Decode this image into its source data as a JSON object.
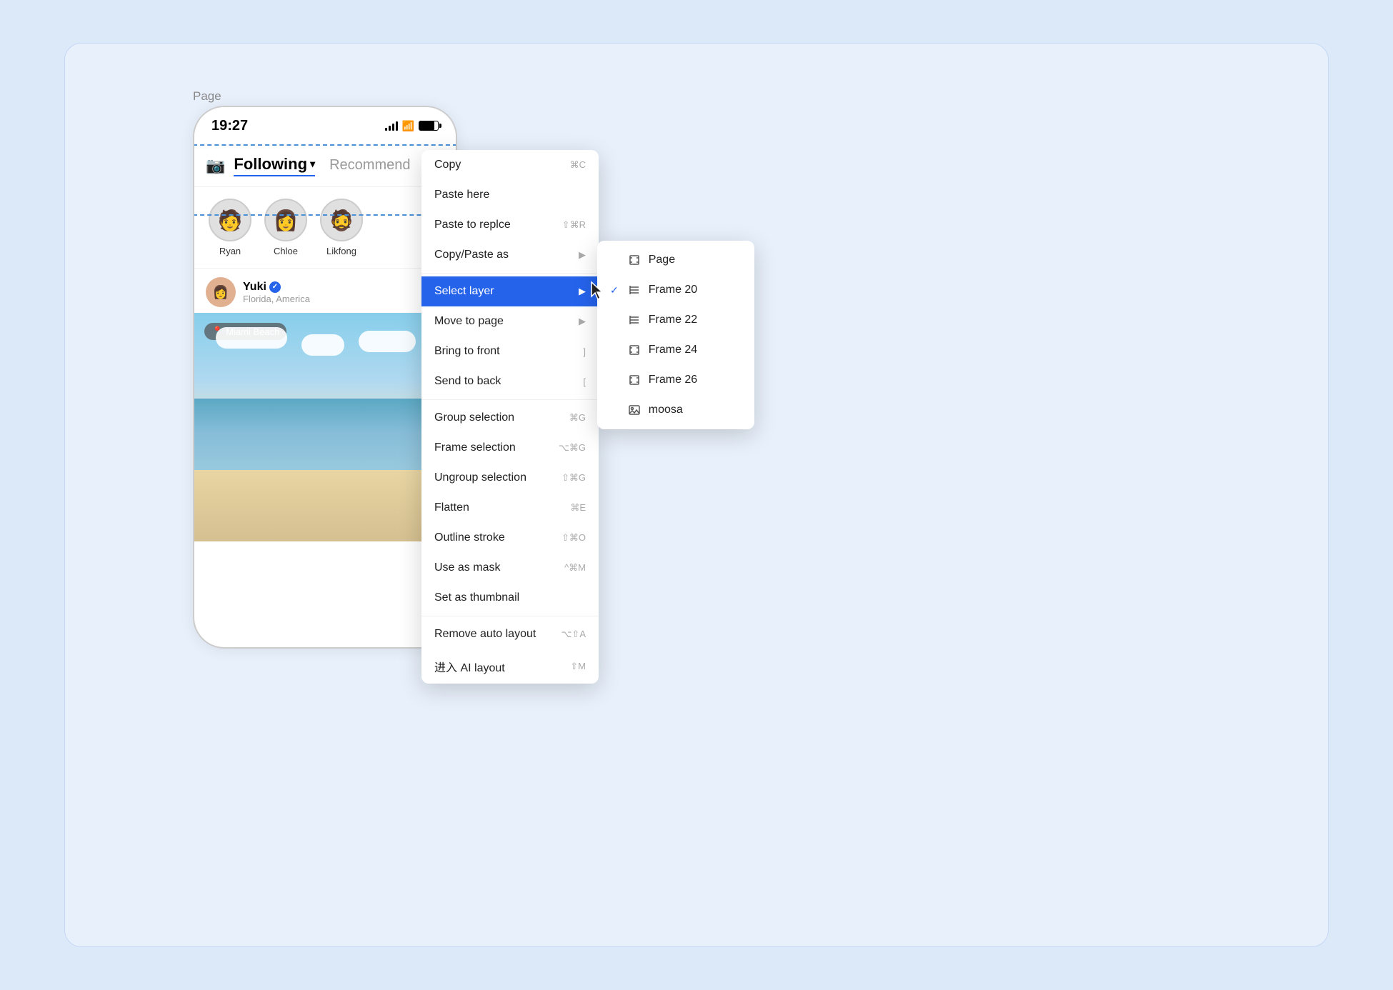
{
  "page": {
    "label": "Page",
    "background": "#dce9f8"
  },
  "phone": {
    "status_time": "19:27",
    "nav_following": "Following",
    "nav_following_arrow": "∨",
    "nav_recommend": "Recommend",
    "stories": [
      {
        "name": "Ryan",
        "emoji": "🧑"
      },
      {
        "name": "Chloe",
        "emoji": "👩"
      },
      {
        "name": "Likfong",
        "emoji": "🧔"
      }
    ],
    "post_username": "Yuki",
    "post_location": "Florida, America",
    "location_tag": "Miami Beach"
  },
  "context_menu": {
    "items": [
      {
        "label": "Copy",
        "shortcut": "⌘C",
        "type": "normal"
      },
      {
        "label": "Paste here",
        "shortcut": "",
        "type": "normal"
      },
      {
        "label": "Paste to replce",
        "shortcut": "⇧⌘R",
        "type": "normal"
      },
      {
        "label": "Copy/Paste as",
        "shortcut": "",
        "type": "arrow"
      },
      {
        "label": "Select layer",
        "shortcut": "",
        "type": "arrow-active"
      },
      {
        "label": "Move to page",
        "shortcut": "",
        "type": "arrow"
      },
      {
        "label": "Bring to front",
        "shortcut": "]",
        "type": "normal"
      },
      {
        "label": "Send to back",
        "shortcut": "[",
        "type": "normal"
      },
      {
        "label": "Group selection",
        "shortcut": "⌘G",
        "type": "normal"
      },
      {
        "label": "Frame selection",
        "shortcut": "⌥⌘G",
        "type": "normal"
      },
      {
        "label": "Ungroup selection",
        "shortcut": "⇧⌘G",
        "type": "normal"
      },
      {
        "label": "Flatten",
        "shortcut": "⌘E",
        "type": "normal"
      },
      {
        "label": "Outline stroke",
        "shortcut": "⇧⌘O",
        "type": "normal"
      },
      {
        "label": "Use as mask",
        "shortcut": "^⌘M",
        "type": "normal"
      },
      {
        "label": "Set as thumbnail",
        "shortcut": "",
        "type": "normal"
      },
      {
        "label": "Remove auto layout",
        "shortcut": "⌥⇧A",
        "type": "normal"
      },
      {
        "label": "进入 AI layout",
        "shortcut": "⇧M",
        "type": "normal"
      }
    ]
  },
  "submenu": {
    "items": [
      {
        "label": "Page",
        "icon": "frame-icon",
        "checked": false
      },
      {
        "label": "Frame 20",
        "icon": "frame-list-icon",
        "checked": true
      },
      {
        "label": "Frame 22",
        "icon": "frame-list-icon",
        "checked": false
      },
      {
        "label": "Frame 24",
        "icon": "frame-icon",
        "checked": false
      },
      {
        "label": "Frame 26",
        "icon": "frame-icon",
        "checked": false
      },
      {
        "label": "moosa",
        "icon": "image-icon",
        "checked": false
      }
    ]
  }
}
